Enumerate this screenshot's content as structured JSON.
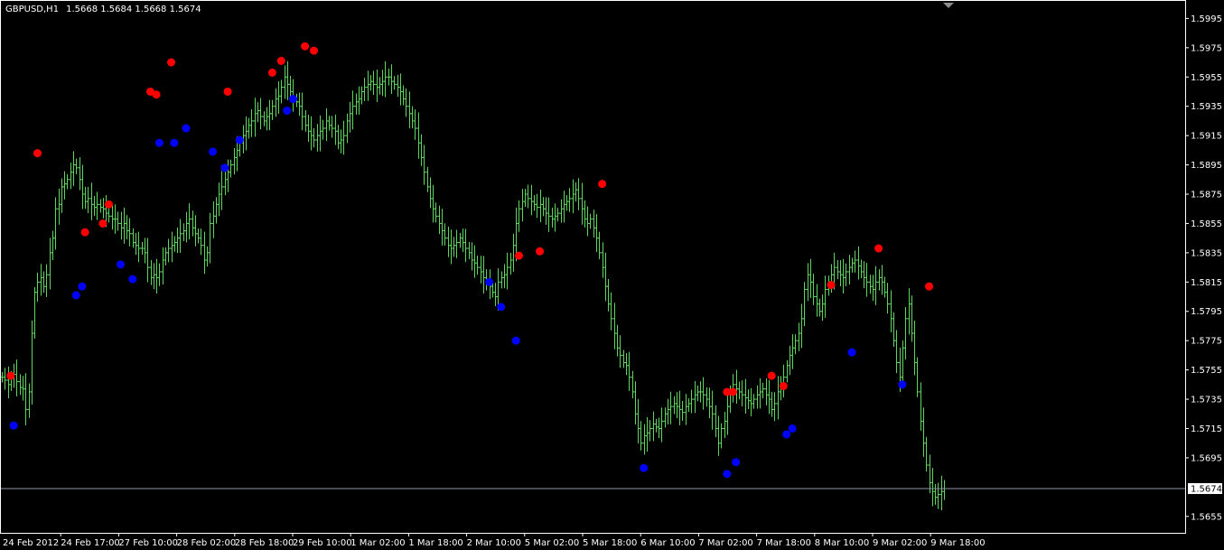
{
  "header": {
    "symbol": "GBPUSD,H1",
    "ohlc": "1.5668 1.5684 1.5668 1.5674"
  },
  "colors": {
    "background": "#000000",
    "bars": "#5fd45f",
    "axis": "#ffffff",
    "price_line": "#8c96a8",
    "fractal_up": "#ff0000",
    "fractal_down": "#0000ff",
    "price_tag_bg": "#ffffff",
    "price_tag_text": "#000000"
  },
  "chart_data": {
    "type": "ohlc",
    "symbol": "GBPUSD",
    "timeframe": "H1",
    "current_price": 1.5674,
    "y_ticks": [
      "1.5995",
      "1.5975",
      "1.5955",
      "1.5935",
      "1.5915",
      "1.5895",
      "1.5875",
      "1.5855",
      "1.5835",
      "1.5815",
      "1.5795",
      "1.5775",
      "1.5755",
      "1.5735",
      "1.5715",
      "1.5695",
      "1.5674",
      "1.5655"
    ],
    "y_range": [
      1.5645,
      1.6004
    ],
    "x_labels": [
      "24 Feb 2012",
      "24 Feb 17:00",
      "27 Feb 10:00",
      "28 Feb 02:00",
      "28 Feb 18:00",
      "29 Feb 10:00",
      "1 Mar 02:00",
      "1 Mar 18:00",
      "2 Mar 10:00",
      "5 Mar 02:00",
      "5 Mar 18:00",
      "6 Mar 10:00",
      "7 Mar 02:00",
      "7 Mar 18:00",
      "8 Mar 10:00",
      "9 Mar 02:00",
      "9 Mar 18:00"
    ],
    "series_close": [
      1.575,
      1.5748,
      1.5745,
      1.575,
      1.5752,
      1.5747,
      1.5743,
      1.5742,
      1.5728,
      1.574,
      1.578,
      1.5808,
      1.5815,
      1.5818,
      1.5812,
      1.582,
      1.5835,
      1.5845,
      1.5865,
      1.5868,
      1.588,
      1.5882,
      1.5885,
      1.589,
      1.5895,
      1.5893,
      1.5885,
      1.5875,
      1.587,
      1.5872,
      1.5868,
      1.5866,
      1.5868,
      1.5866,
      1.5865,
      1.5862,
      1.586,
      1.5858,
      1.5858,
      1.5855,
      1.5852,
      1.5855,
      1.585,
      1.5848,
      1.5842,
      1.584,
      1.5838,
      1.5838,
      1.5835,
      1.5825,
      1.5818,
      1.582,
      1.5818,
      1.5822,
      1.583,
      1.5835,
      1.5838,
      1.584,
      1.5842,
      1.5845,
      1.5848,
      1.585,
      1.5855,
      1.5858,
      1.5852,
      1.5848,
      1.5845,
      1.584,
      1.583,
      1.5835,
      1.5855,
      1.586,
      1.5868,
      1.5875,
      1.588,
      1.5885,
      1.589,
      1.5895,
      1.59,
      1.5905,
      1.591,
      1.5915,
      1.5918,
      1.5922,
      1.5925,
      1.593,
      1.5932,
      1.5928,
      1.5925,
      1.5928,
      1.593,
      1.5935,
      1.594,
      1.5942,
      1.5948,
      1.5955,
      1.595,
      1.5945,
      1.594,
      1.5938,
      1.5935,
      1.5928,
      1.5922,
      1.5918,
      1.5915,
      1.5912,
      1.5915,
      1.5918,
      1.592,
      1.5925,
      1.5922,
      1.592,
      1.5918,
      1.591,
      1.5912,
      1.5915,
      1.5925,
      1.593,
      1.5935,
      1.5938,
      1.594,
      1.5945,
      1.5948,
      1.595,
      1.5952,
      1.595,
      1.5948,
      1.595,
      1.5952,
      1.5955,
      1.5955,
      1.5952,
      1.595,
      1.5948,
      1.5945,
      1.594,
      1.5935,
      1.593,
      1.5925,
      1.592,
      1.591,
      1.59,
      1.589,
      1.588,
      1.5872,
      1.5865,
      1.586,
      1.5855,
      1.585,
      1.5845,
      1.584,
      1.5838,
      1.584,
      1.5842,
      1.5845,
      1.5842,
      1.5838,
      1.5835,
      1.583,
      1.5828,
      1.5825,
      1.5822,
      1.5818,
      1.5815,
      1.5812,
      1.5808,
      1.5805,
      1.5815,
      1.5818,
      1.582,
      1.5825,
      1.583,
      1.584,
      1.5855,
      1.5865,
      1.587,
      1.5875,
      1.5872,
      1.587,
      1.5868,
      1.5866,
      1.5868,
      1.5865,
      1.5862,
      1.586,
      1.5858,
      1.586,
      1.5862,
      1.5865,
      1.5868,
      1.587,
      1.5872,
      1.5875,
      1.5878,
      1.5872,
      1.5865,
      1.5858,
      1.5855,
      1.5858,
      1.5852,
      1.5845,
      1.5835,
      1.5825,
      1.5812,
      1.58,
      1.579,
      1.578,
      1.577,
      1.5765,
      1.576,
      1.5758,
      1.575,
      1.574,
      1.5725,
      1.5715,
      1.5705,
      1.571,
      1.5712,
      1.5715,
      1.5718,
      1.5716,
      1.5715,
      1.572,
      1.5725,
      1.5728,
      1.573,
      1.5732,
      1.573,
      1.5728,
      1.5726,
      1.573,
      1.5732,
      1.5735,
      1.5738,
      1.574,
      1.574,
      1.5738,
      1.5735,
      1.573,
      1.5725,
      1.5715,
      1.5705,
      1.5715,
      1.572,
      1.573,
      1.574,
      1.5745,
      1.5742,
      1.574,
      1.5738,
      1.5736,
      1.5734,
      1.5732,
      1.5735,
      1.5738,
      1.574,
      1.5742,
      1.5738,
      1.5735,
      1.5728,
      1.5732,
      1.574,
      1.5745,
      1.575,
      1.5758,
      1.5765,
      1.577,
      1.5775,
      1.578,
      1.579,
      1.581,
      1.582,
      1.5815,
      1.5805,
      1.58,
      1.5795,
      1.58,
      1.581,
      1.5815,
      1.582,
      1.5825,
      1.5822,
      1.582,
      1.5818,
      1.5822,
      1.5825,
      1.5828,
      1.583,
      1.5826,
      1.5822,
      1.5818,
      1.5815,
      1.5812,
      1.581,
      1.5815,
      1.5818,
      1.5815,
      1.5808,
      1.58,
      1.579,
      1.5775,
      1.576,
      1.575,
      1.577,
      1.579,
      1.58,
      1.578,
      1.576,
      1.574,
      1.572,
      1.5705,
      1.569,
      1.5678,
      1.5672,
      1.5668,
      1.567,
      1.5672,
      1.5674
    ],
    "fractals_up": [
      [
        3,
        1.5751
      ],
      [
        12,
        1.5903
      ],
      [
        28,
        1.5849
      ],
      [
        34,
        1.5855
      ],
      [
        36,
        1.5868
      ],
      [
        50,
        1.5945
      ],
      [
        52,
        1.5943
      ],
      [
        57,
        1.5965
      ],
      [
        76,
        1.5945
      ],
      [
        91,
        1.5958
      ],
      [
        94,
        1.5966
      ],
      [
        102,
        1.5976
      ],
      [
        105,
        1.5973
      ],
      [
        174,
        1.5833
      ],
      [
        181,
        1.5836
      ],
      [
        202,
        1.5882
      ],
      [
        244,
        1.574
      ],
      [
        246,
        1.574
      ],
      [
        259,
        1.5751
      ],
      [
        263,
        1.5744
      ],
      [
        279,
        1.5813
      ],
      [
        295,
        1.5838
      ],
      [
        312,
        1.5812
      ]
    ],
    "fractals_down": [
      [
        4,
        1.5717
      ],
      [
        25,
        1.5806
      ],
      [
        27,
        1.5812
      ],
      [
        40,
        1.5827
      ],
      [
        44,
        1.5817
      ],
      [
        53,
        1.591
      ],
      [
        58,
        1.591
      ],
      [
        62,
        1.592
      ],
      [
        71,
        1.5904
      ],
      [
        75,
        1.5893
      ],
      [
        80,
        1.5912
      ],
      [
        96,
        1.5932
      ],
      [
        98,
        1.594
      ],
      [
        164,
        1.5815
      ],
      [
        168,
        1.5798
      ],
      [
        173,
        1.5775
      ],
      [
        216,
        1.5688
      ],
      [
        244,
        1.5684
      ],
      [
        247,
        1.5692
      ],
      [
        264,
        1.5711
      ],
      [
        266,
        1.5715
      ],
      [
        286,
        1.5767
      ],
      [
        303,
        1.5745
      ]
    ]
  }
}
